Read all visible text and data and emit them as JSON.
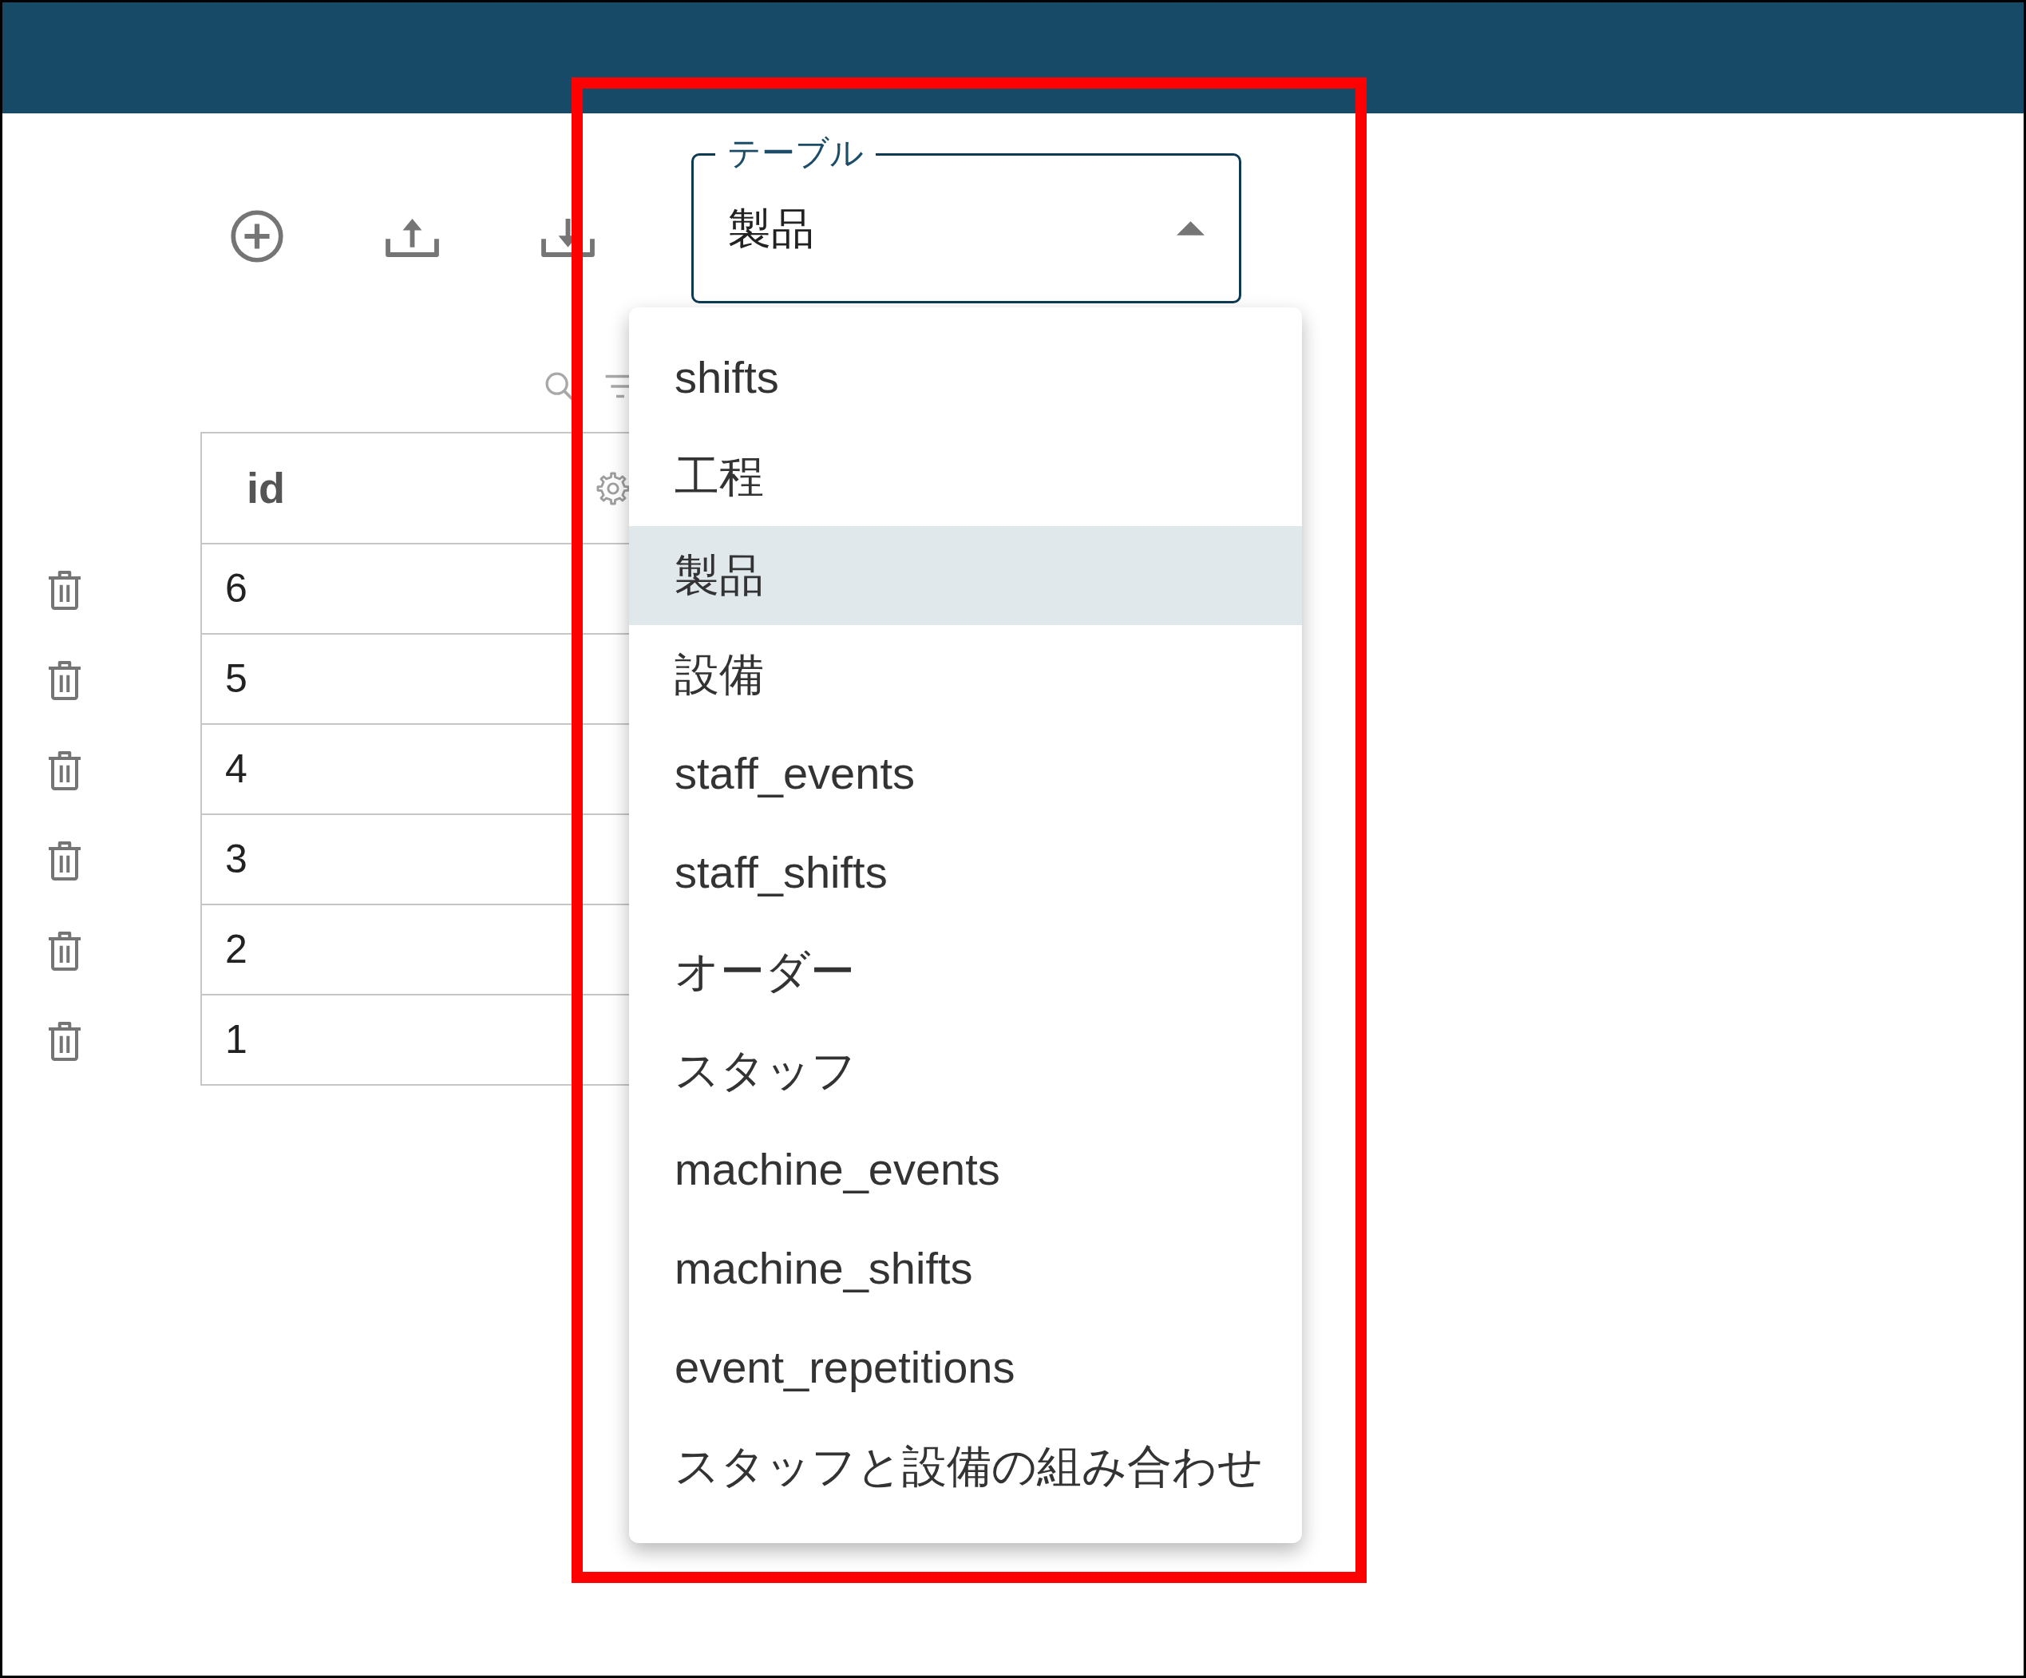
{
  "table_select": {
    "label": "テーブル",
    "value": "製品",
    "expanded": true,
    "options": [
      {
        "label": "shifts",
        "selected": false
      },
      {
        "label": "工程",
        "selected": false
      },
      {
        "label": "製品",
        "selected": true
      },
      {
        "label": "設備",
        "selected": false
      },
      {
        "label": "staff_events",
        "selected": false
      },
      {
        "label": "staff_shifts",
        "selected": false
      },
      {
        "label": "オーダー",
        "selected": false
      },
      {
        "label": "スタッフ",
        "selected": false
      },
      {
        "label": "machine_events",
        "selected": false
      },
      {
        "label": "machine_shifts",
        "selected": false
      },
      {
        "label": "event_repetitions",
        "selected": false
      },
      {
        "label": "スタッフと設備の組み合わせ",
        "selected": false
      }
    ]
  },
  "table": {
    "columns": [
      "id"
    ],
    "rows": [
      [
        "6"
      ],
      [
        "5"
      ],
      [
        "4"
      ],
      [
        "3"
      ],
      [
        "2"
      ],
      [
        "1"
      ]
    ]
  }
}
